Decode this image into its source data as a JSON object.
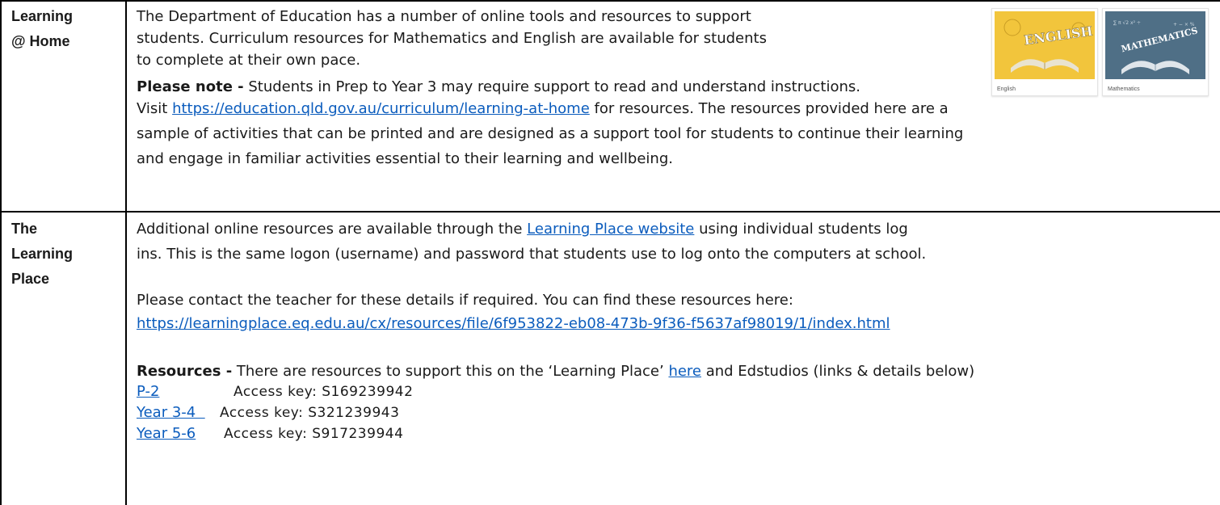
{
  "rows": [
    {
      "label": [
        "Learning",
        "@ Home"
      ],
      "para1": [
        "The Department of Education has a number of online tools and resources to support",
        "students. Curriculum resources for Mathematics and English are available for students",
        "to complete at their own pace."
      ],
      "note_bold": "Please note -",
      "note_text": " Students in Prep to Year 3 may require support to read and understand instructions.",
      "visit_prefix": "Visit ",
      "visit_link": "https://education.qld.gov.au/curriculum/learning-at-home",
      "visit_suffix": " for resources. The resources provided here are a",
      "visit_cont": [
        "sample of activities that can be printed and are designed as a support tool for students to continue their learning",
        "and engage in familiar activities essential to their learning and wellbeing."
      ],
      "thumbnails": [
        {
          "caption": "English",
          "art_word": "ENGLISH",
          "bg": "#f2c53c"
        },
        {
          "caption": "Mathematics",
          "art_word": "MATHEMATICS",
          "bg": "#4f6f86"
        }
      ]
    },
    {
      "label": [
        "The",
        "Learning",
        "Place"
      ],
      "line1_prefix": "Additional online resources are available through the ",
      "line1_link": "Learning Place website",
      "line1_suffix": " using individual students log",
      "line2": "ins. This is the same logon (username) and password that students use to log onto the computers at school.",
      "line3": "Please contact the teacher for these details if required. You can find these resources here:",
      "url": "https://learningplace.eq.edu.au/cx/resources/file/6f953822-eb08-473b-9f36-f5637af98019/1/index.html",
      "res_bold": "Resources -",
      "res_text": " There are resources to support this on the ‘Learning Place’ ",
      "res_link": "here",
      "res_suffix": " and Edstudios (links & details below)",
      "access": [
        {
          "link": "P-2",
          "key": "Access key: S169239942"
        },
        {
          "link": "Year 3-4  ",
          "key": "Access key: S321239943"
        },
        {
          "link": "Year 5-6",
          "key": "Access key: S917239944"
        }
      ]
    }
  ],
  "colors": {
    "link": "#0b5cbd",
    "border": "#000000",
    "text": "#1a1a1a"
  }
}
